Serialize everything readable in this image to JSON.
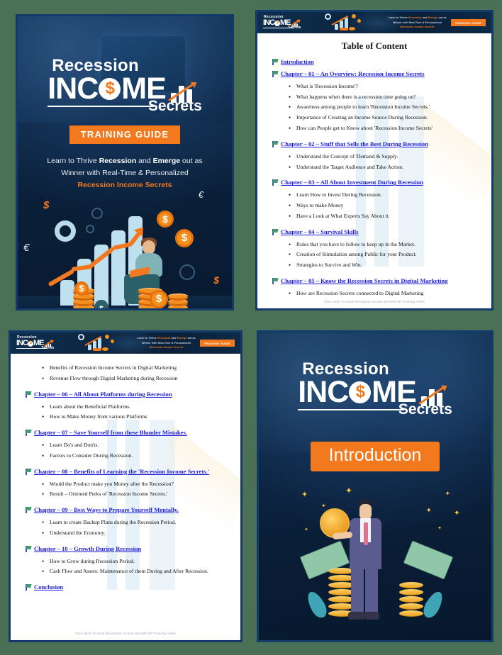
{
  "theme": {
    "background_color": "#4a7055",
    "page_border_color": "#123a6b",
    "accent_orange": "#f2791d",
    "link_blue": "#1d1ddd",
    "dark_navy": "#0d2746"
  },
  "brand": {
    "line1": "Recession",
    "line2": "INCOME",
    "line2_coin_letter": "$",
    "line3": "Secrets"
  },
  "cover": {
    "badge": "TRAINING GUIDE",
    "tagline_line1_pre": "Learn to Thrive ",
    "tagline_line1_bold1": "Recession",
    "tagline_line1_mid": " and ",
    "tagline_line1_bold2": "Emerge",
    "tagline_line1_post": " out as",
    "tagline_line2": "Winner with Real-Time & Personalized",
    "tagline_line3": "Recession Income Secrets",
    "illustration": "growth-chart-man-laptop-coins"
  },
  "banner": {
    "text_line1_pre": "Learn to Thrive ",
    "text_line1_bold1": "Recession",
    "text_line1_mid": " and ",
    "text_line1_bold2": "Emerge",
    "text_line1_post": " out as",
    "text_line2": "Winner with Real-Time & Personalized",
    "text_line3": "Recession Income Secrets",
    "badge": "TRAINING GUIDE"
  },
  "toc_page": {
    "title": "Table of Content",
    "footer": "Click Here To Grab Recession Income Secrets HD Training Video",
    "entries": [
      {
        "link": "Introduction",
        "bullets": []
      },
      {
        "link": "Chapter – 01 – An Overview: Recession Income Secrets",
        "bullets": [
          "What is 'Recession Income'?",
          "What happens when there is a recession time going on?",
          "Awareness among people to learn 'Recession Income Secrets.'",
          "Importance of Creating an Income Source During Recession.",
          "How can People get to Know about 'Recession Income Secrets'"
        ]
      },
      {
        "link": "Chapter – 02 – Stuff that Sells the Best During Recession",
        "bullets": [
          "Understand the Concept of 'Demand & Supply.",
          "Understand the Target Audience and Take Action."
        ]
      },
      {
        "link": "Chapter – 03 – All About Investment During Recession",
        "bullets": [
          "Learn How to Invest During Recession.",
          "Ways to make Money",
          "Have a Look at What Experts Say About it."
        ]
      },
      {
        "link": "Chapter – 04 – Survival Skills",
        "bullets": [
          "Rules that you have to follow to keep up in the Market.",
          "Creation of Stimulation among Public for your Product.",
          "Strategies to Survive and Win."
        ]
      },
      {
        "link": "Chapter – 05 – Know the Recession Secrets in Digital Marketing",
        "bullets": [
          "How are Recession Secrets connected to Digital Marketing"
        ]
      }
    ]
  },
  "toc_page2": {
    "footer": "Click Here To Grab Recession Income Secrets HD Training Video",
    "lead_bullets": [
      "Benefits of Recession Income Secrets in Digital Marketing",
      "Revenue Flow through Digital Marketing during Recession"
    ],
    "entries": [
      {
        "link": "Chapter – 06 – All About Platforms during Recession",
        "bullets": [
          "Learn about the Beneficial Platforms.",
          "How to Make Money from various Platforms"
        ]
      },
      {
        "link": "Chapter – 07 – Save Yourself from these Blunder Mistakes.",
        "bullets": [
          "Learn Do's and Don'ts.",
          "Factors to Consider During Recession."
        ]
      },
      {
        "link": "Chapter – 08 – Benefits of Learning the 'Recession Income Secrets.'",
        "bullets": [
          "Would the Product make you Money after the Recession?",
          "Result – Oriented Perks of 'Recession Income Secrets.'"
        ]
      },
      {
        "link": "Chapter – 09 – Best Ways to Prepare Yourself  Mentally.",
        "bullets": [
          "Learn to create Backup Plans during the Recession Period.",
          "Understand the Economy."
        ]
      },
      {
        "link": "Chapter – 10 – Growth During Recession",
        "bullets": [
          "How to Grow during Recession Period.",
          "Cash Flow and Assets: Maintenance of them During and After Recession."
        ]
      },
      {
        "link": "Conclusion",
        "bullets": []
      }
    ]
  },
  "intro_page": {
    "badge": "Introduction",
    "illustration": "businessman-with-coin-banknotes-coin-stacks"
  }
}
